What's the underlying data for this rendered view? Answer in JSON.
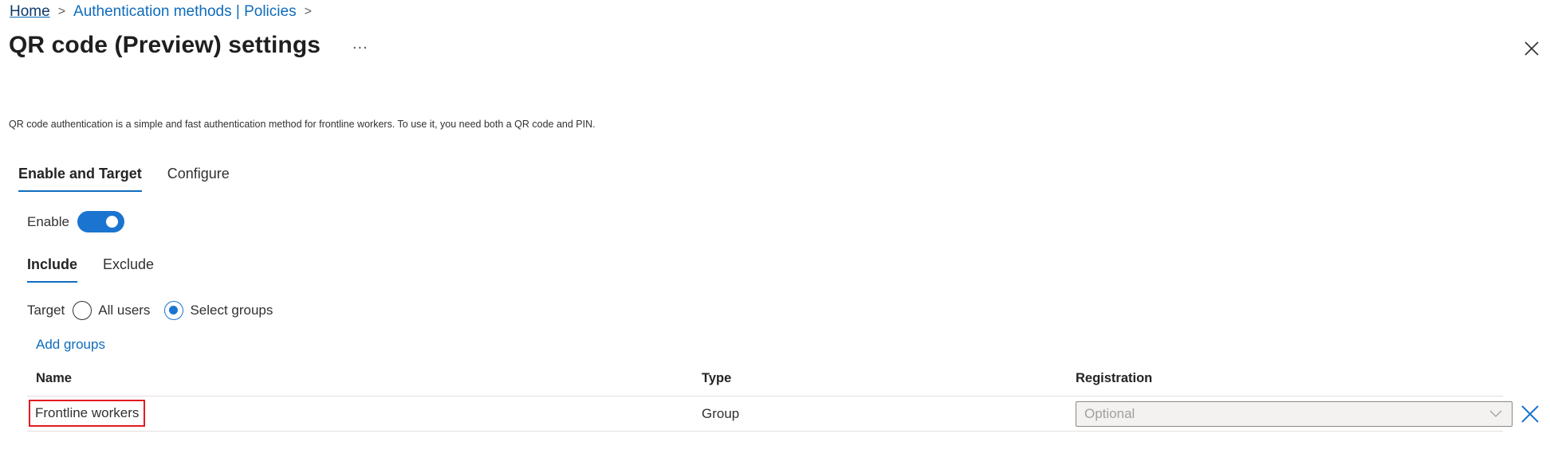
{
  "breadcrumb": {
    "items": [
      "Home",
      "Authentication methods | Policies"
    ],
    "separator": ">"
  },
  "header": {
    "title": "QR code (Preview) settings",
    "more_label": "...",
    "close_icon": "close-icon"
  },
  "description": "QR code authentication is a simple and fast authentication method for frontline workers. To use it, you need both a QR code and PIN.",
  "tabs": [
    {
      "label": "Enable and Target",
      "active": true
    },
    {
      "label": "Configure",
      "active": false
    }
  ],
  "enable": {
    "label": "Enable",
    "on": true,
    "accent": "#1b74d0"
  },
  "subtabs": [
    {
      "label": "Include",
      "active": true
    },
    {
      "label": "Exclude",
      "active": false
    }
  ],
  "target": {
    "label": "Target",
    "options": [
      {
        "label": "All users",
        "selected": false
      },
      {
        "label": "Select groups",
        "selected": true
      }
    ]
  },
  "add_groups_label": "Add groups",
  "table": {
    "columns": [
      "Name",
      "Type",
      "Registration"
    ],
    "rows": [
      {
        "name": "Frontline workers",
        "type": "Group",
        "registration": "Optional",
        "highlighted": true,
        "highlight_color": "#e11b22"
      }
    ]
  }
}
